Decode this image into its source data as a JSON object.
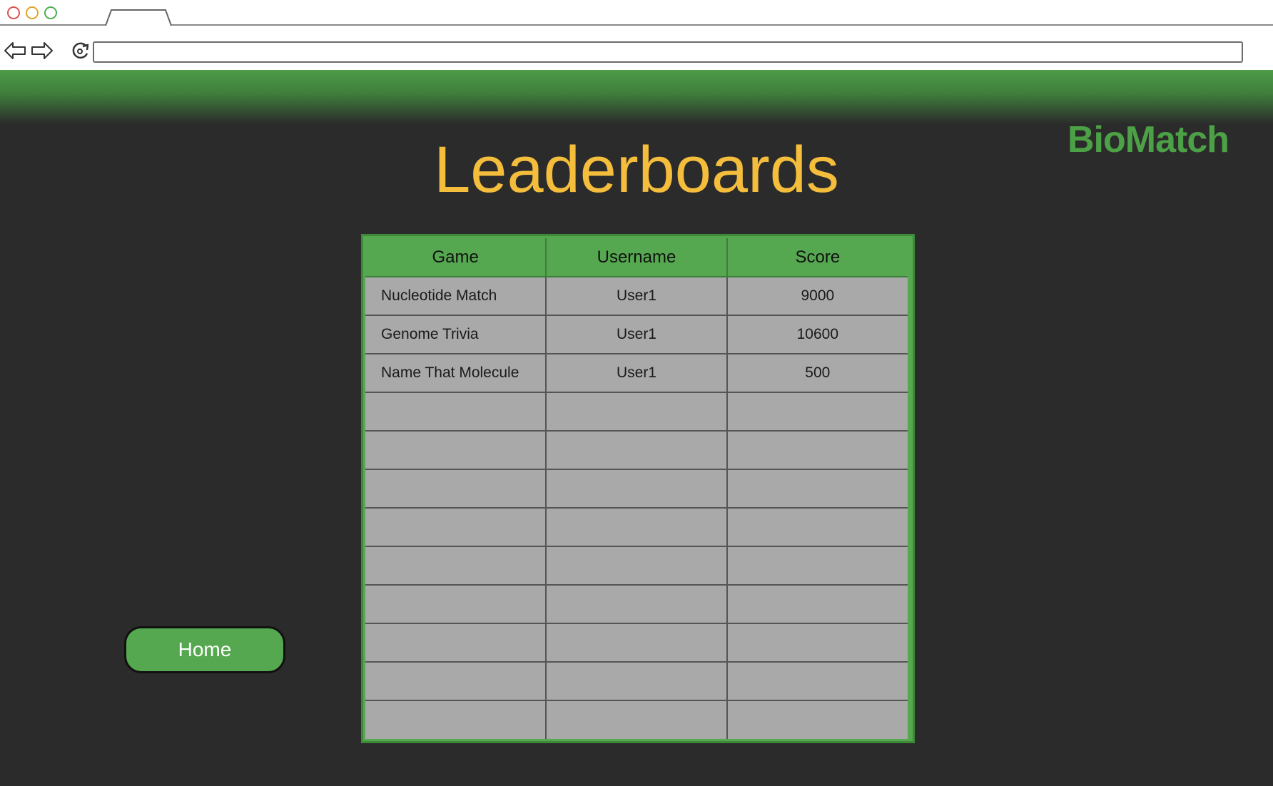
{
  "browser": {
    "url": "",
    "icons": {
      "back": "arrow-left-icon",
      "forward": "arrow-right-icon",
      "reload": "reload-icon"
    },
    "traffic_lights": [
      "#d9534f",
      "#e0a526",
      "#4caf50"
    ]
  },
  "brand": {
    "logo_text": "BioMatch",
    "logo_color": "#4ca046"
  },
  "page": {
    "title": "Leaderboards",
    "title_color": "#f4bd3c"
  },
  "leaderboard": {
    "columns": [
      "Game",
      "Username",
      "Score"
    ],
    "rows": [
      {
        "game": "Nucleotide Match",
        "username": "User1",
        "score": "9000"
      },
      {
        "game": "Genome Trivia",
        "username": "User1",
        "score": "10600"
      },
      {
        "game": "Name That Molecule",
        "username": "User1",
        "score": "500"
      },
      {
        "game": "",
        "username": "",
        "score": ""
      },
      {
        "game": "",
        "username": "",
        "score": ""
      },
      {
        "game": "",
        "username": "",
        "score": ""
      },
      {
        "game": "",
        "username": "",
        "score": ""
      },
      {
        "game": "",
        "username": "",
        "score": ""
      },
      {
        "game": "",
        "username": "",
        "score": ""
      },
      {
        "game": "",
        "username": "",
        "score": ""
      },
      {
        "game": "",
        "username": "",
        "score": ""
      },
      {
        "game": "",
        "username": "",
        "score": ""
      }
    ]
  },
  "nav": {
    "home_label": "Home"
  },
  "colors": {
    "background": "#2b2b2b",
    "accent_green": "#55a850",
    "cell_gray": "#a9a9a9"
  }
}
